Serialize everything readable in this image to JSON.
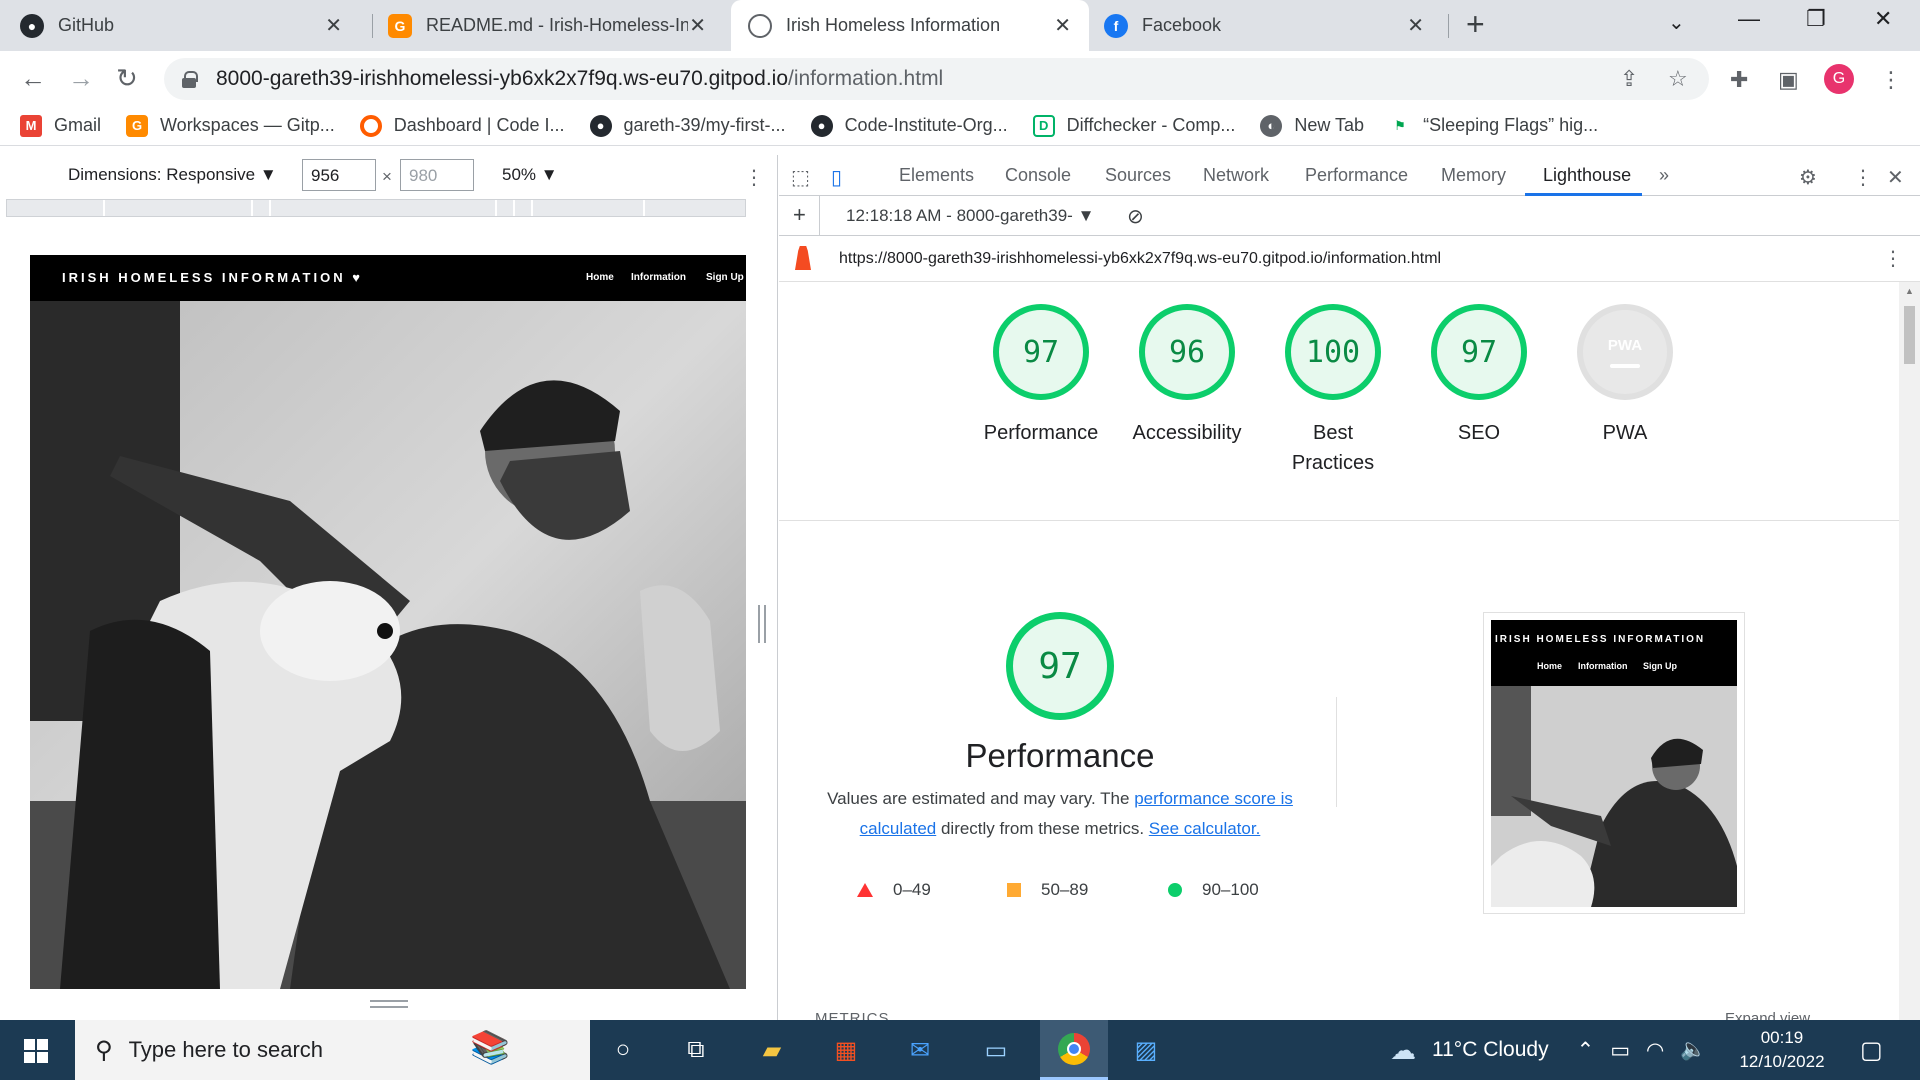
{
  "tabs": [
    {
      "title": "GitHub",
      "icon": "github-icon"
    },
    {
      "title": "README.md - Irish-Homeless-Inf",
      "icon": "gitpod-icon"
    },
    {
      "title": "Irish Homeless Information",
      "icon": "globe-icon",
      "active": true
    },
    {
      "title": "Facebook",
      "icon": "facebook-icon"
    }
  ],
  "url": {
    "host": "8000-gareth39-irishhomelessi-yb6xk2x7f9q.ws-eu70.gitpod.io",
    "path": "/information.html"
  },
  "profile_initial": "G",
  "bookmarks": [
    "Gmail",
    "Workspaces — Gitp...",
    "Dashboard | Code I...",
    "gareth-39/my-first-...",
    "Code-Institute-Org...",
    "Diffchecker - Comp...",
    "New Tab",
    "“Sleeping Flags” hig..."
  ],
  "device_toolbar": {
    "dimensions_label": "Dimensions: Responsive",
    "width": "956",
    "height": "980",
    "zoom": "50%"
  },
  "site": {
    "brand": "IRISH HOMELESS INFORMATION",
    "nav": [
      "Home",
      "Information",
      "Sign Up"
    ]
  },
  "devtools": {
    "tabs": [
      "Elements",
      "Console",
      "Sources",
      "Network",
      "Performance",
      "Memory",
      "Lighthouse"
    ],
    "report_label": "12:18:18 AM - 8000-gareth39-",
    "report_url": "https://8000-gareth39-irishhomelessi-yb6xk2x7f9q.ws-eu70.gitpod.io/information.html"
  },
  "scores": [
    {
      "value": "97",
      "label": "Performance"
    },
    {
      "value": "96",
      "label": "Accessibility"
    },
    {
      "value": "100",
      "label": "Best Practices"
    },
    {
      "value": "97",
      "label": "SEO"
    },
    {
      "value": "PWA",
      "label": "PWA"
    }
  ],
  "performance": {
    "score": "97",
    "title": "Performance",
    "desc_1": "Values are estimated and may vary. The ",
    "link_1": "performance score is calculated",
    "desc_2": " directly from these metrics. ",
    "link_2": "See calculator.",
    "legend": [
      "0–49",
      "50–89",
      "90–100"
    ]
  },
  "metrics_label": "METRICS",
  "expand_label": "Expand view",
  "taskbar": {
    "search_placeholder": "Type here to search",
    "weather": "11°C  Cloudy",
    "time": "00:19",
    "date": "12/10/2022"
  },
  "colors": {
    "pass": "#0cce6b",
    "average": "#ffaa33",
    "fail": "#ff3333",
    "accent": "#1a73e8"
  }
}
